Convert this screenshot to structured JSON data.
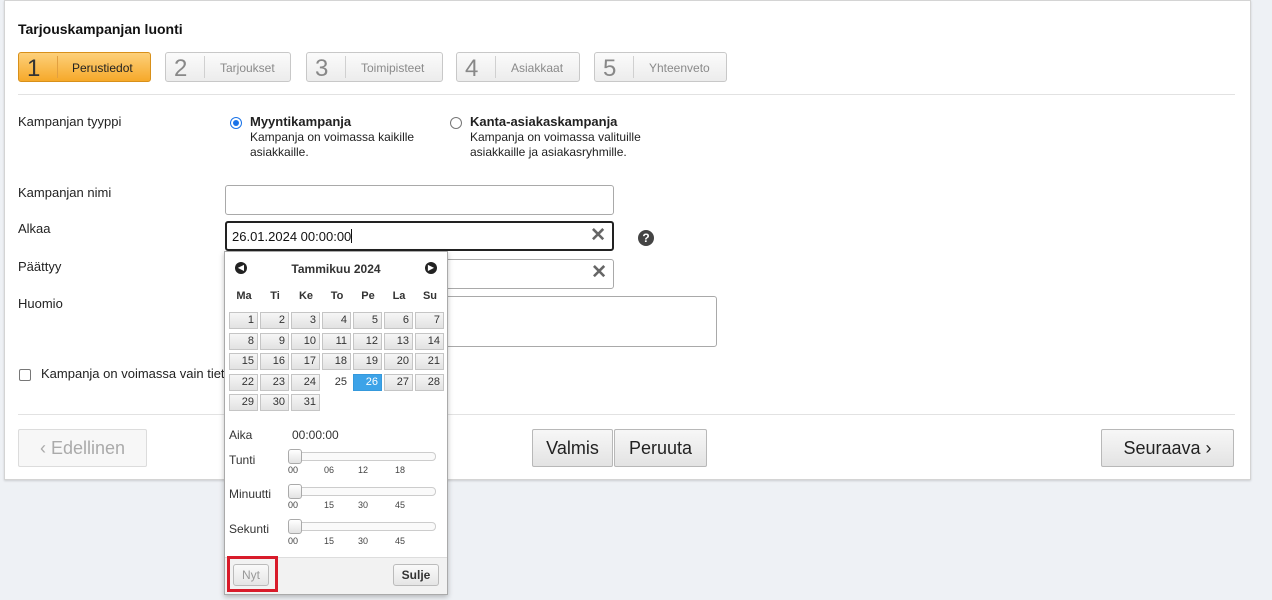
{
  "page_title": "Tarjouskampanjan luonti",
  "steps": [
    {
      "num": "1",
      "label": "Perustiedot"
    },
    {
      "num": "2",
      "label": "Tarjoukset"
    },
    {
      "num": "3",
      "label": "Toimipisteet"
    },
    {
      "num": "4",
      "label": "Asiakkaat"
    },
    {
      "num": "5",
      "label": "Yhteenveto"
    }
  ],
  "campaign_type": {
    "label": "Kampanjan tyyppi",
    "options": [
      {
        "title": "Myyntikampanja",
        "desc1": "Kampanja on voimassa kaikille",
        "desc2": "asiakkaille."
      },
      {
        "title": "Kanta-asiakaskampanja",
        "desc1": "Kampanja on voimassa valituille",
        "desc2": "asiakkaille ja asiakasryhmille."
      }
    ]
  },
  "fields": {
    "name_label": "Kampanjan nimi",
    "start_label": "Alkaa",
    "start_value": "26.01.2024 00:00:00",
    "end_label": "Päättyy",
    "note_label": "Huomio",
    "clear_symbol": "✕",
    "help_symbol": "?"
  },
  "checkbox_label": "Kampanja on voimassa vain tiett",
  "buttons": {
    "prev": "‹  Edellinen",
    "ok": "Valmis",
    "cancel": "Peruuta",
    "next": "Seuraava  ›"
  },
  "datepicker": {
    "month": "Tammikuu 2024",
    "prev_symbol": "◀",
    "next_symbol": "▶",
    "weekdays": [
      "Ma",
      "Ti",
      "Ke",
      "To",
      "Pe",
      "La",
      "Su"
    ],
    "weeks": [
      [
        "1",
        "2",
        "3",
        "4",
        "5",
        "6",
        "7"
      ],
      [
        "8",
        "9",
        "10",
        "11",
        "12",
        "13",
        "14"
      ],
      [
        "15",
        "16",
        "17",
        "18",
        "19",
        "20",
        "21"
      ],
      [
        "22",
        "23",
        "24",
        "25",
        "26",
        "27",
        "28"
      ],
      [
        "29",
        "30",
        "31",
        "",
        "",
        "",
        ""
      ]
    ],
    "today": "25",
    "selected": "26",
    "time_label": "Aika",
    "time_value": "00:00:00",
    "hour_label": "Tunti",
    "hour_ticks": [
      "00",
      "06",
      "12",
      "18"
    ],
    "hour_value": 0,
    "minute_label": "Minuutti",
    "minute_ticks": [
      "00",
      "15",
      "30",
      "45"
    ],
    "minute_value": 0,
    "second_label": "Sekunti",
    "second_ticks": [
      "00",
      "15",
      "30",
      "45"
    ],
    "second_value": 0,
    "now_button": "Nyt",
    "close_button": "Sulje",
    "highlight_color": "#d81b2a",
    "selected_color": "#3da3e8"
  }
}
